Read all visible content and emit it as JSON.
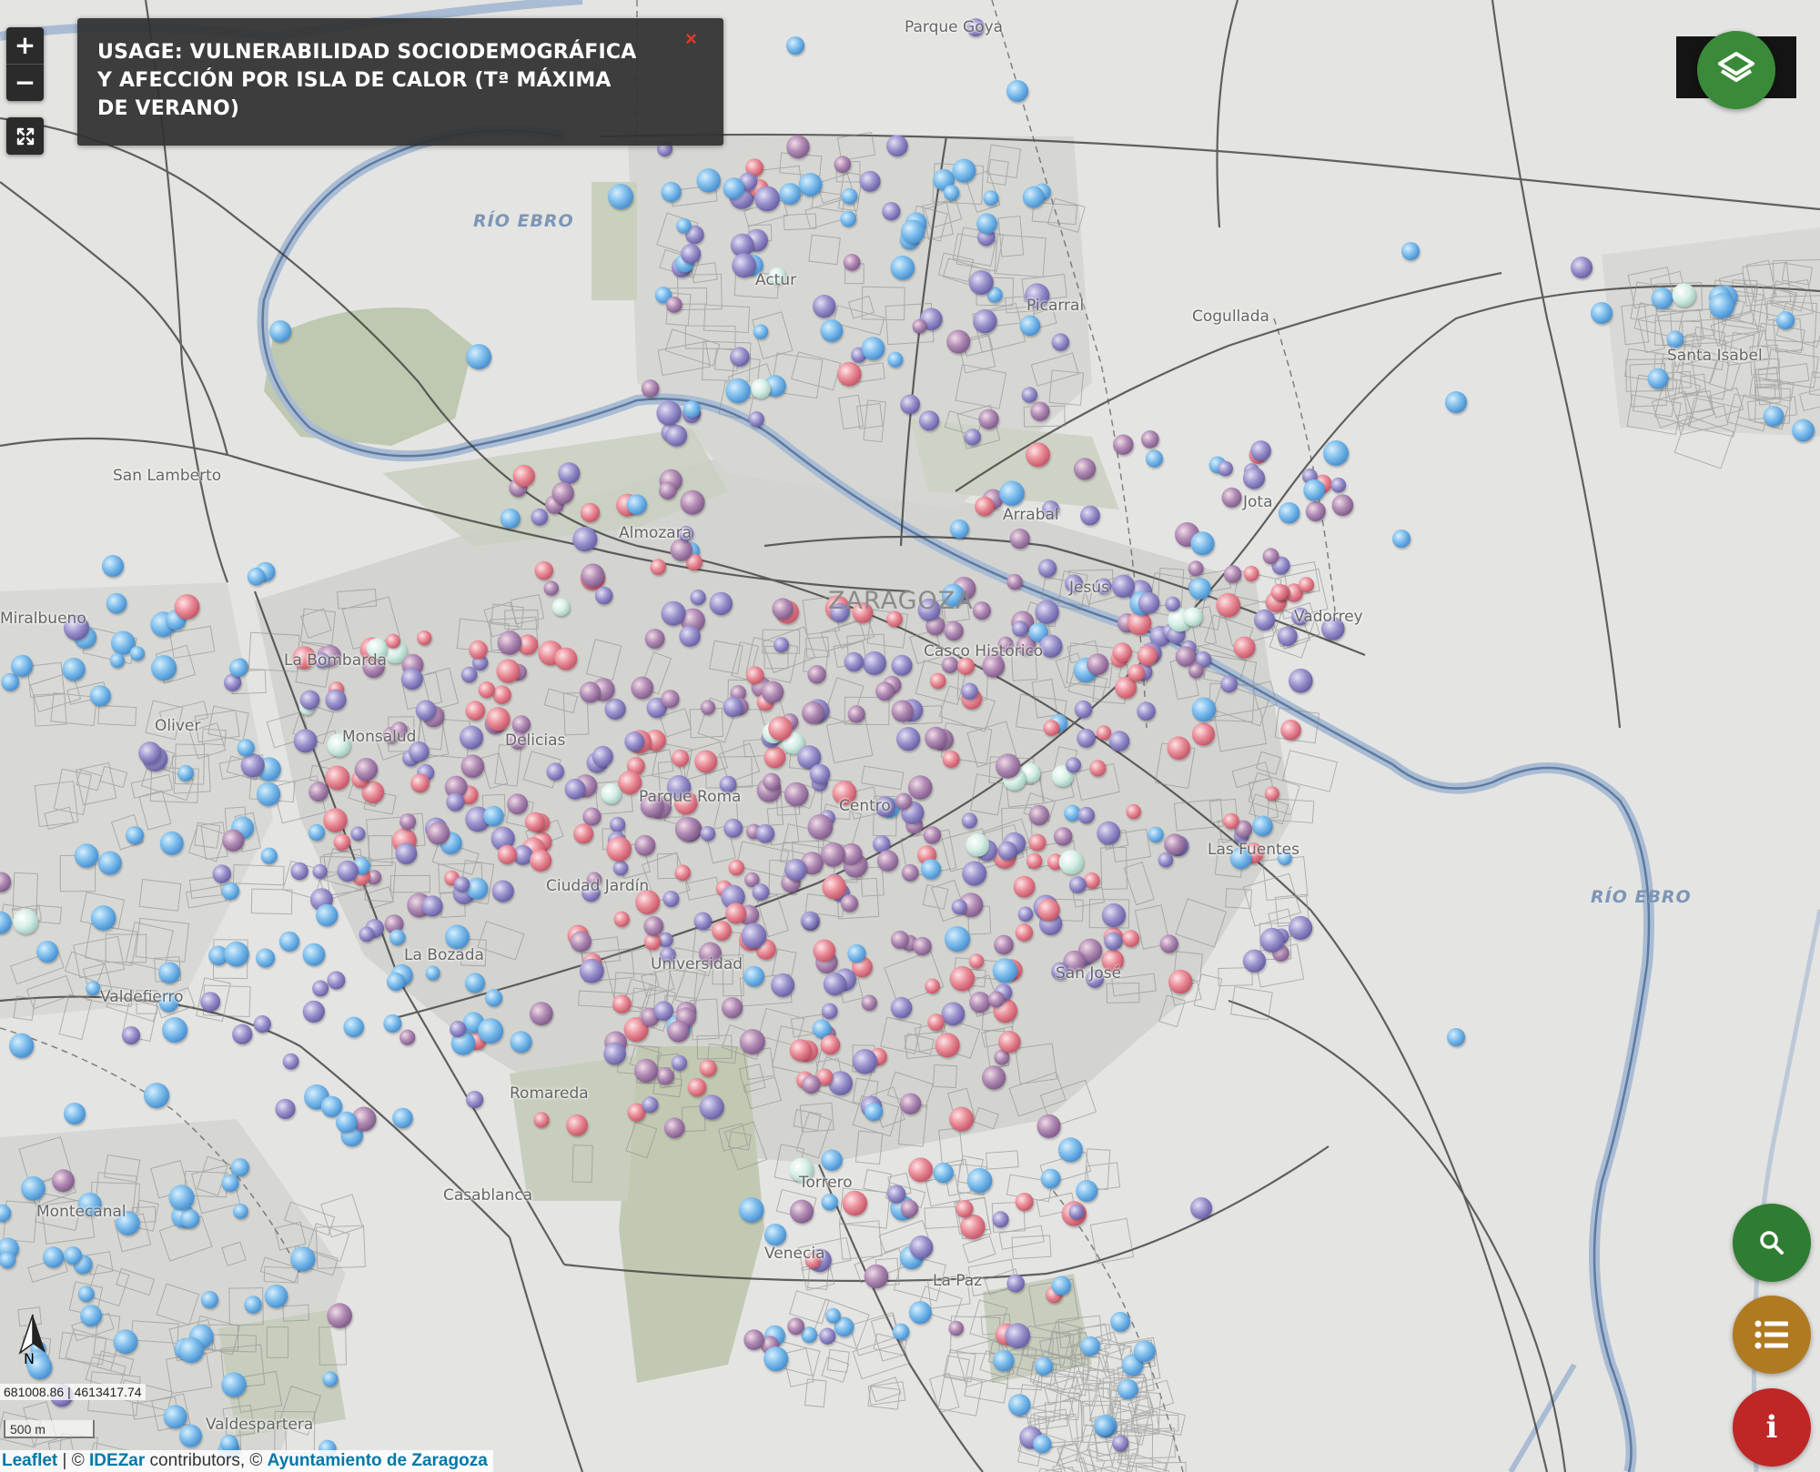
{
  "title_panel": {
    "text": "USAGE: VULNERABILIDAD SOCIODEMOGRÁFICA Y AFECCIÓN POR ISLA DE CALOR (Tª MÁXIMA DE VERANO)",
    "close_symbol": "×"
  },
  "controls": {
    "zoom_in": "+",
    "zoom_out": "−",
    "fullscreen_icon": "expand-icon",
    "layers_icon": "layers-icon",
    "search_icon": "search-icon",
    "legend_icon": "list-icon",
    "info_label": "i"
  },
  "map_labels": {
    "city": "ZARAGOZA",
    "rivers": [
      "RÍO EBRO",
      "RÍO EBRO"
    ],
    "places": [
      "Parque Goya",
      "Actur",
      "Picarral",
      "Cogullada",
      "Santa Isabel",
      "San Lamberto",
      "Almozara",
      "Arrabal",
      "Jota",
      "Vadorrey",
      "Jesús",
      "Casco Histórico",
      "Miralbueno",
      "La Bombarda",
      "Oliver",
      "Monsalud",
      "Delicias",
      "Parque Roma",
      "Centro",
      "Las Fuentes",
      "Ciudad Jardín",
      "La Bozada",
      "Universidad",
      "San José",
      "Valdefierro",
      "Romareda",
      "Casablanca",
      "Montecanal",
      "Venecia",
      "La Paz",
      "Valdespartera",
      "Torrero"
    ]
  },
  "coordinates": {
    "text": "681008.86 | 4613417.74"
  },
  "scale_bar": {
    "label": "500 m"
  },
  "north_arrow": {
    "label": "N"
  },
  "attribution": {
    "leaflet": "Leaflet",
    "sep1": " | © ",
    "idezar": "IDEZar",
    "mid": " contributors, © ",
    "ayto": "Ayuntamiento de Zaragoza"
  },
  "colors": {
    "accent_green": "#2e7d32",
    "legend_ochre": "#b07a22",
    "info_red": "#bf2626",
    "close_red": "#e03a2c",
    "river": "#a9bcd3",
    "green_area": "#bfc8b0",
    "low_vulnerability": "#6fb5e8",
    "mid_vulnerability": "#8f86c4",
    "high_vulnerability": "#e8828f"
  },
  "legend_classes": [
    "low_vulnerability",
    "mid_vulnerability",
    "high_vulnerability"
  ]
}
